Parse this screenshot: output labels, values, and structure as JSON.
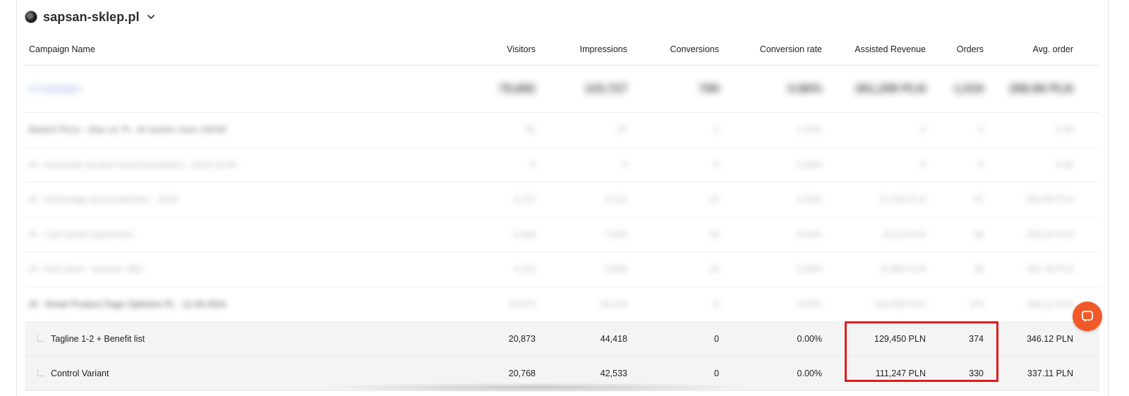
{
  "site": {
    "name": "sapsan-sklep.pl",
    "logo_icon": "site-logo-icon",
    "dropdown_icon": "chevron-down-icon"
  },
  "columns": [
    "Campaign Name",
    "Visitors",
    "Impressions",
    "Conversions",
    "Conversion rate",
    "Assisted Revenue",
    "Orders",
    "Avg. order"
  ],
  "summary": {
    "name": "6 Campaigns",
    "values": [
      "75,682",
      "115,727",
      "769",
      "0.66%",
      "261,299 PLN",
      "1,019",
      "256.66 PLN"
    ]
  },
  "campaigns": [
    {
      "name": "Basket Pizza - Stan za 7h - At section rows 100/30",
      "values": [
        "65",
        "97",
        "1",
        "1.53%",
        "0",
        "0",
        "0.00"
      ]
    },
    {
      "name": "AI - Automatic product recommendation - 2023-10-04",
      "values": [
        "0",
        "0",
        "0",
        "0.00%",
        "0",
        "0",
        "0.00"
      ]
    },
    {
      "name": "AI - Homepage personalization - 2023",
      "values": [
        "3,721",
        "6,112",
        "12",
        "0.32%",
        "12,410 PLN",
        "41",
        "302.68 PLN"
      ]
    },
    {
      "name": "AI - Cart upsell experiment",
      "values": [
        "5,903",
        "7,845",
        "32",
        "0.54%",
        "8,212 PLN",
        "28",
        "293.29 PLN"
      ]
    },
    {
      "name": "AI - Exit intent - summer offer",
      "values": [
        "4,211",
        "5,960",
        "18",
        "0.43%",
        "11,980 PLN",
        "36",
        "332.78 PLN"
      ]
    },
    {
      "name": "AI - Smart Product Page Optimize PL - 11.09.2024",
      "values": [
        "20,873",
        "44,418",
        "0",
        "0.00%",
        "129,450 PLN",
        "374",
        "346.12 PLN"
      ]
    }
  ],
  "variants": [
    {
      "name": "Tagline 1-2 + Benefit list",
      "values": [
        "20,873",
        "44,418",
        "0",
        "0.00%",
        "129,450 PLN",
        "374",
        "346.12 PLN"
      ]
    },
    {
      "name": "Control Variant",
      "values": [
        "20,768",
        "42,533",
        "0",
        "0.00%",
        "111,247 PLN",
        "330",
        "337.11 PLN"
      ]
    }
  ],
  "colors": {
    "highlight": "#e21b1b",
    "chat": "#f05a28"
  },
  "chat_icon": "chat-bubble-icon"
}
